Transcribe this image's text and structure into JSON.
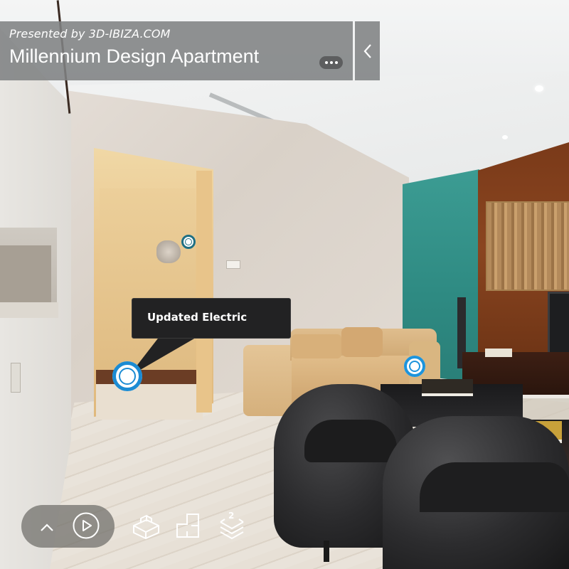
{
  "header": {
    "presented_by": "Presented by 3D-IBIZA.COM",
    "title": "Millennium Design Apartment",
    "more_icon": "ellipsis-icon",
    "collapse_icon": "chevron-left-icon"
  },
  "tooltip": {
    "text": "Updated Electric"
  },
  "tags": [
    {
      "name": "mattertag-updated-electric",
      "state": "active",
      "color": "#1b8bd3"
    },
    {
      "name": "mattertag-statue",
      "state": "default",
      "color": "#1f6f82"
    },
    {
      "name": "mattertag-sofa",
      "state": "default",
      "color": "#1d94dc"
    }
  ],
  "controls": {
    "items": [
      {
        "name": "expand-up",
        "icon": "chevron-up-icon"
      },
      {
        "name": "play-tour",
        "icon": "play-icon"
      },
      {
        "name": "dollhouse-view",
        "icon": "dollhouse-icon"
      },
      {
        "name": "floorplan-view",
        "icon": "floorplan-icon"
      },
      {
        "name": "floor-selector",
        "icon": "floors-icon",
        "badge": "2"
      }
    ]
  }
}
